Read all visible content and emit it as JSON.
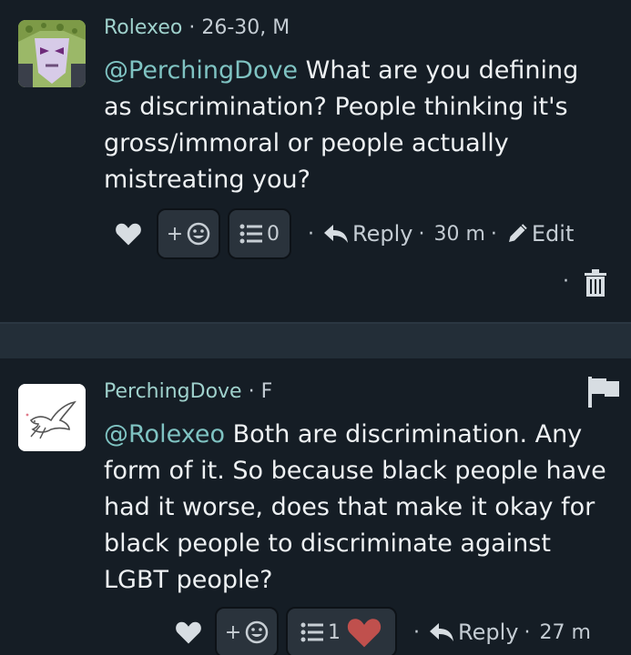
{
  "comments": [
    {
      "author": "Rolexeo",
      "info": "26-30, M",
      "mention": "@PerchingDove",
      "text": " What are you defining as discrimination? People thinking it's gross/immoral or people actually mistreating you?",
      "add_reaction": "+",
      "list_count": "0",
      "reply_label": "Reply",
      "time": "30 m",
      "edit_label": "Edit"
    },
    {
      "author": "PerchingDove",
      "info": "F",
      "mention": "@Rolexeo",
      "text": " Both are discrimination. Any form of it. So because black people have had it worse, does that make it okay for black people to discriminate against LGBT people?",
      "add_reaction": "+",
      "list_count": "1",
      "reply_label": "Reply",
      "time": "27 m"
    }
  ],
  "separator": "·",
  "colors": {
    "background": "#151d25",
    "author": "#9fd1cc",
    "mention": "#7fc3c2",
    "reaction_heart": "#c0504d"
  },
  "icons": [
    "heart-icon",
    "smiley-icon",
    "list-icon",
    "reply-arrow-icon",
    "pencil-icon",
    "trash-icon",
    "flag-icon",
    "dove-icon"
  ]
}
